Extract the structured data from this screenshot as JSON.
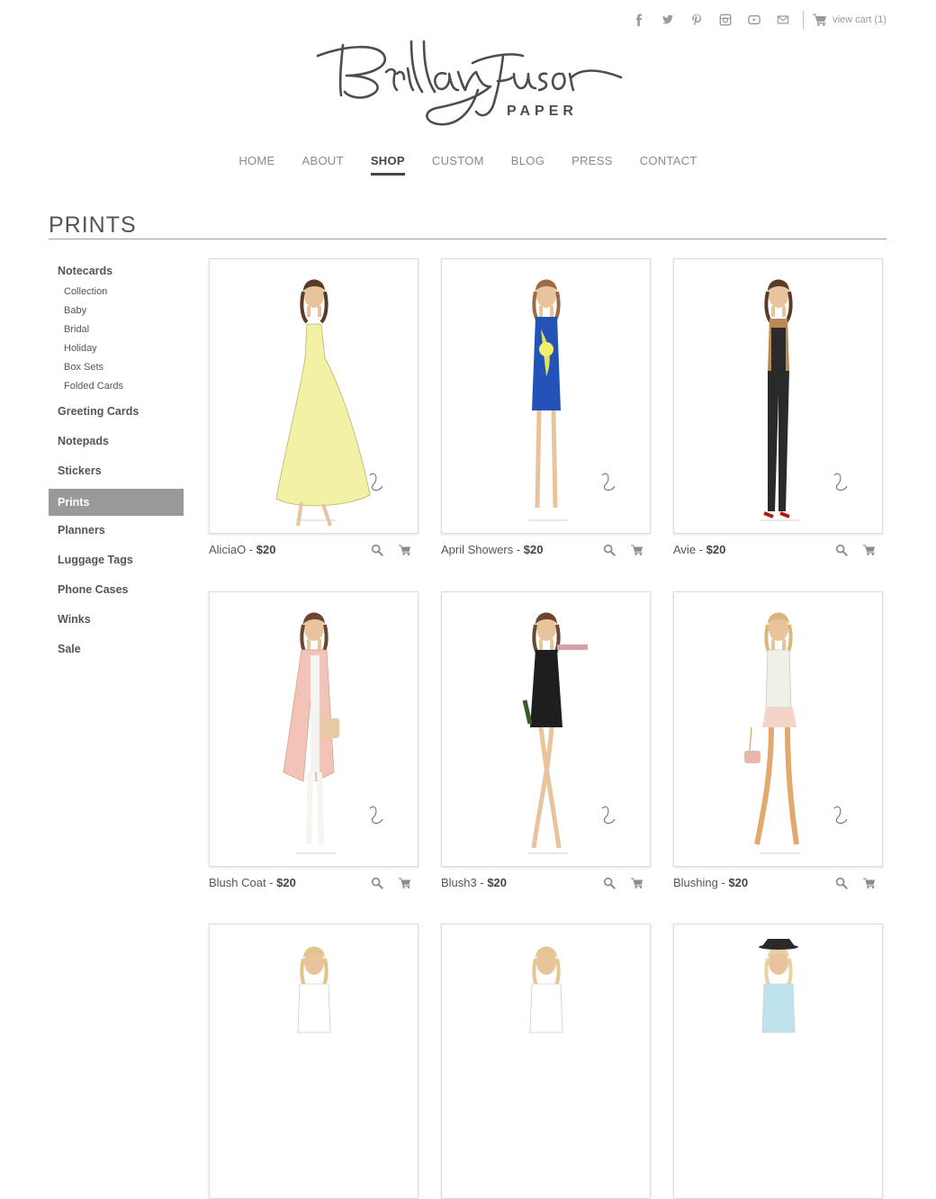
{
  "header": {
    "social_icons": [
      "facebook-icon",
      "twitter-icon",
      "pinterest-icon",
      "instagram-icon",
      "youtube-icon",
      "email-icon"
    ],
    "cart_label": "view cart (1)"
  },
  "logo": {
    "script_text": "Brittany Fuson",
    "subtitle": "PAPER"
  },
  "nav": {
    "items": [
      "HOME",
      "ABOUT",
      "SHOP",
      "CUSTOM",
      "BLOG",
      "PRESS",
      "CONTACT"
    ],
    "active": "SHOP"
  },
  "page_title": "PRINTS",
  "sidebar": {
    "notecards": {
      "label": "Notecards",
      "children": [
        "Collection",
        "Baby",
        "Bridal",
        "Holiday",
        "Box Sets",
        "Folded Cards"
      ]
    },
    "items": [
      "Greeting Cards",
      "Notepads",
      "Stickers",
      "Prints",
      "Planners",
      "Luggage Tags",
      "Phone Cases",
      "Winks",
      "Sale"
    ],
    "active": "Prints"
  },
  "products": [
    {
      "name": "AliciaO",
      "price": "$20",
      "sep": " - ",
      "dress": "#f3f1a6",
      "hair": "#5b3a26"
    },
    {
      "name": "April Showers",
      "price": "$20",
      "sep": " - ",
      "dress": "#2453b8",
      "hair": "#9a6b44"
    },
    {
      "name": "Avie",
      "price": "$20",
      "sep": " - ",
      "dress": "#2a2a2a",
      "hair": "#5b3a26"
    },
    {
      "name": "Blush Coat",
      "price": "$20",
      "sep": " - ",
      "dress": "#f2c3b6",
      "hair": "#6b4630"
    },
    {
      "name": "Blush3",
      "price": "$20",
      "sep": " - ",
      "dress": "#1e1e1e",
      "hair": "#6b4630"
    },
    {
      "name": "Blushing",
      "price": "$20",
      "sep": " - ",
      "dress": "#f4d4c8",
      "hair": "#d8b77a"
    }
  ],
  "partial_products": [
    {
      "hair": "#e0c48a",
      "top": "#ffffff"
    },
    {
      "hair": "#e2c792",
      "top": "#ffffff"
    },
    {
      "hair": "#e8d2a0",
      "top": "#bfe3ec"
    }
  ],
  "colors": {
    "accent": "#999999",
    "text": "#555555",
    "rule": "#9e9e9e"
  }
}
